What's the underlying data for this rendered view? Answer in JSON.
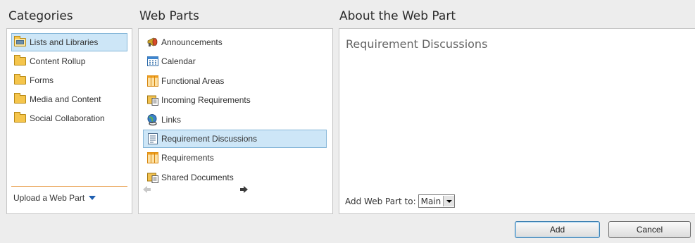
{
  "headers": {
    "categories": "Categories",
    "web_parts": "Web Parts",
    "about": "About the Web Part"
  },
  "categories": {
    "items": [
      {
        "label": "Lists and Libraries",
        "icon": "open-folder-icon",
        "selected": true
      },
      {
        "label": "Content Rollup",
        "icon": "folder-icon"
      },
      {
        "label": "Forms",
        "icon": "folder-icon"
      },
      {
        "label": "Media and Content",
        "icon": "folder-icon"
      },
      {
        "label": "Social Collaboration",
        "icon": "folder-icon"
      }
    ],
    "upload_label": "Upload a Web Part"
  },
  "web_parts": {
    "items": [
      {
        "label": "Announcements",
        "icon": "megaphone-icon"
      },
      {
        "label": "Calendar",
        "icon": "calendar-icon"
      },
      {
        "label": "Functional Areas",
        "icon": "list-icon"
      },
      {
        "label": "Incoming Requirements",
        "icon": "document-library-icon"
      },
      {
        "label": "Links",
        "icon": "globe-link-icon"
      },
      {
        "label": "Requirement Discussions",
        "icon": "discussion-icon",
        "selected": true
      },
      {
        "label": "Requirements",
        "icon": "list-icon"
      },
      {
        "label": "Shared Documents",
        "icon": "document-library-icon"
      }
    ]
  },
  "about": {
    "selected_name": "Requirement Discussions",
    "add_to_label": "Add Web Part to:",
    "zone_value": "Main"
  },
  "buttons": {
    "add": "Add",
    "cancel": "Cancel"
  },
  "colors": {
    "selection_bg": "#cde6f7",
    "selection_border": "#85b6d8",
    "divider": "#e79b45",
    "link_blue": "#1f5fb0"
  }
}
